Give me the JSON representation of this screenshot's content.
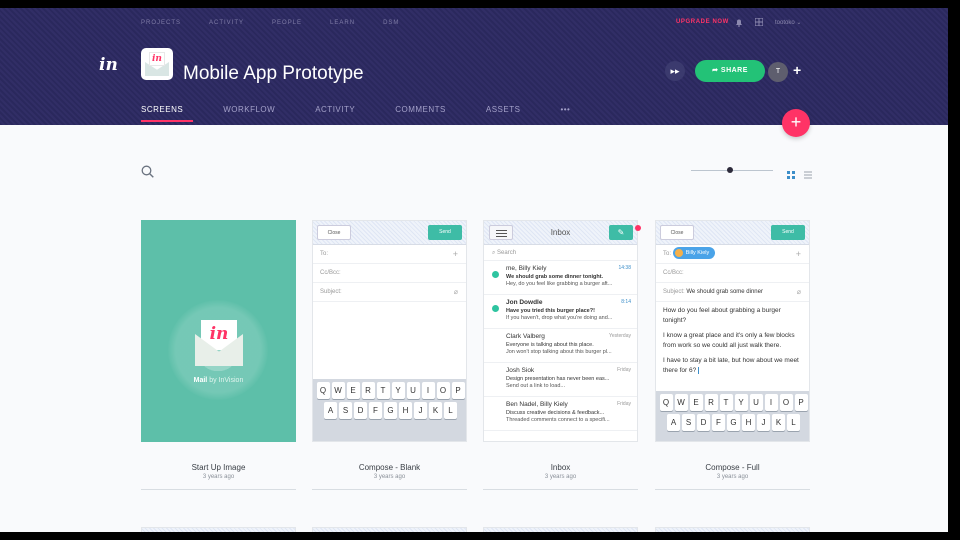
{
  "header": {
    "top_nav": [
      "PROJECTS",
      "ACTIVITY",
      "PEOPLE",
      "LEARN",
      "DSM"
    ],
    "upgrade_label": "UPGRADE NOW",
    "user_name": "tootoko",
    "project_title": "Mobile App Prototype",
    "share_label": "SHARE",
    "avatar_initial": "T",
    "tabs": [
      "SCREENS",
      "WORKFLOW",
      "ACTIVITY",
      "COMMENTS",
      "ASSETS",
      "•••"
    ],
    "active_tab": "SCREENS"
  },
  "screens": [
    {
      "name": "Start Up Image",
      "age": "3 years ago"
    },
    {
      "name": "Compose - Blank",
      "age": "3 years ago"
    },
    {
      "name": "Inbox",
      "age": "3 years ago"
    },
    {
      "name": "Compose - Full",
      "age": "3 years ago"
    }
  ],
  "startup": {
    "brand": "Mail",
    "brand_sub": "by InVision"
  },
  "compose": {
    "close": "Close",
    "send": "Send",
    "to": "To:",
    "ccbcc": "Cc/Bcc:",
    "subject": "Subject:",
    "kb_row1": [
      "Q",
      "W",
      "E",
      "R",
      "T",
      "Y",
      "U",
      "I",
      "O",
      "P"
    ],
    "kb_row2": [
      "A",
      "S",
      "D",
      "F",
      "G",
      "H",
      "J",
      "K",
      "L"
    ]
  },
  "inbox": {
    "title": "Inbox",
    "search": "Search",
    "messages": [
      {
        "from": "me, Billy Kiely",
        "time": "14:38",
        "subject": "We should grab some dinner tonight.",
        "preview": "Hey, do you feel like grabbing a burger aft...",
        "unread": true
      },
      {
        "from": "Jon Dowdle",
        "time": "8:14",
        "subject": "Have you tried this burger place?!",
        "preview": "If you haven't, drop what you're doing and...",
        "unread": true
      },
      {
        "from": "Clark Valberg",
        "time": "Yesterday",
        "subject": "Everyone is talking about this place.",
        "preview": "Jon won't stop talking about this burger pl...",
        "unread": false
      },
      {
        "from": "Josh Siok",
        "time": "Friday",
        "subject": "Design presentation has never been eas...",
        "preview": "Send out a link to load...",
        "unread": false
      },
      {
        "from": "Ben Nadel, Billy Kiely",
        "time": "Friday",
        "subject": "Discuss creative decisions & feedback...",
        "preview": "Threaded comments connect to a specifi...",
        "unread": false
      }
    ]
  },
  "compose_full": {
    "to_chip": "Billy Kiely",
    "subject_value": "We should grab some dinner",
    "body": [
      "How do you feel about grabbing a burger tonight?",
      "I know a great place and it's only a few blocks from work so we could all just walk there.",
      "I have to stay a bit late, but how about we meet there for 6?"
    ]
  },
  "colors": {
    "accent": "#ff3366",
    "header_bg": "#2d2a63",
    "share_green": "#23c277",
    "teal": "#3ebca6"
  }
}
